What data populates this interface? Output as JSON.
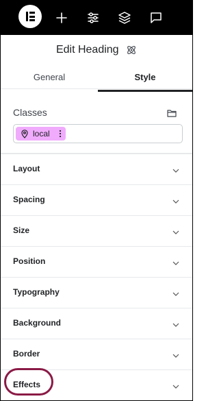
{
  "toolbar": {
    "icons": [
      "elementor-logo-icon",
      "plus-icon",
      "sliders-icon",
      "layers-icon",
      "chat-icon"
    ]
  },
  "header": {
    "title": "Edit Heading",
    "icon": "atom-icon"
  },
  "tabs": [
    {
      "label": "General",
      "active": false
    },
    {
      "label": "Style",
      "active": true
    }
  ],
  "classes": {
    "label": "Classes",
    "chip_label": "local",
    "chip_color": "#f0abfc"
  },
  "sections": [
    {
      "label": "Layout"
    },
    {
      "label": "Spacing"
    },
    {
      "label": "Size"
    },
    {
      "label": "Position"
    },
    {
      "label": "Typography"
    },
    {
      "label": "Background"
    },
    {
      "label": "Border"
    },
    {
      "label": "Effects"
    }
  ],
  "colors": {
    "toolbar_bg": "#000000",
    "highlight_ring": "#8a1a45",
    "text": "#1f2124"
  }
}
